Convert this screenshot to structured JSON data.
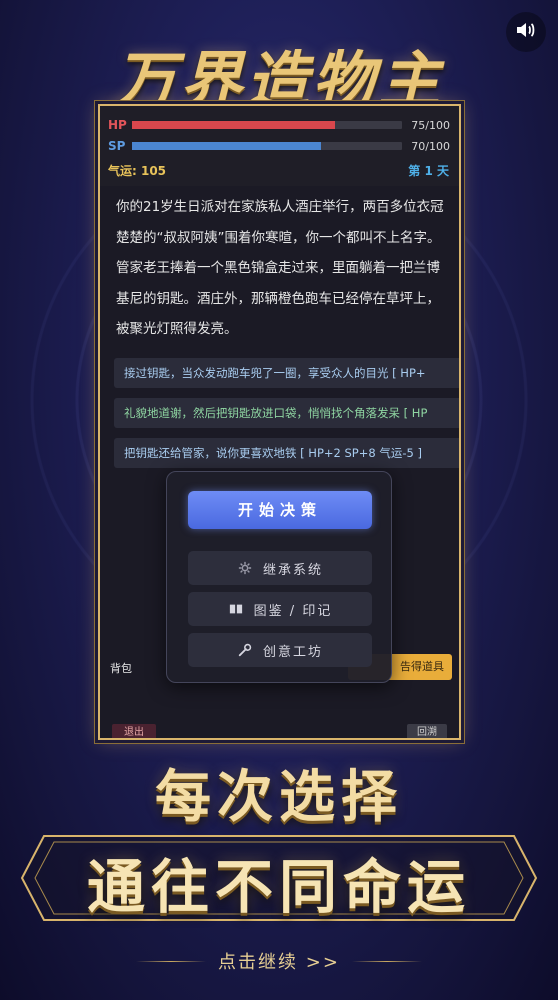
{
  "title": "万界造物主",
  "stats": {
    "hp": {
      "label": "HP",
      "current": 75,
      "max": 100,
      "text": "75/100",
      "color": "#d9474d"
    },
    "sp": {
      "label": "SP",
      "current": 70,
      "max": 100,
      "text": "70/100",
      "color": "#4b86d1"
    },
    "luck": "气运: 105",
    "day": "第 1 天"
  },
  "story": "你的21岁生日派对在家族私人酒庄举行，两百多位衣冠楚楚的“叔叔阿姨”围着你寒暄，你一个都叫不上名字。管家老王捧着一个黑色锦盒走过来，里面躺着一把兰博基尼的钥匙。酒庄外，那辆橙色跑车已经停在草坪上，被聚光灯照得发亮。",
  "choices": [
    {
      "text": "接过钥匙，当众发动跑车兜了一圈，享受众人的目光 [ HP+"
    },
    {
      "text": "礼貌地道谢，然后把钥匙放进口袋，悄悄找个角落发呆 [ HP"
    },
    {
      "text": "把钥匙还给管家，说你更喜欢地铁 [ HP+2  SP+8  气运-5 ]"
    }
  ],
  "bottom_bar": {
    "bag_label": "背包",
    "item_button": "告得道具",
    "exit_button": "退出",
    "back_button": "回溯"
  },
  "menu": {
    "start": "开始决策",
    "items": [
      {
        "label": "继承系统",
        "icon": "gear-icon"
      },
      {
        "label": "图鉴 / 印记",
        "icon": "book-icon"
      },
      {
        "label": "创意工坊",
        "icon": "wrench-icon"
      }
    ]
  },
  "slogan": {
    "line1": "每次选择",
    "line2": "通往不同命运"
  },
  "continue": "点击继续 >>",
  "colors": {
    "gold": "#e9c678",
    "start_button": "#5a78ea",
    "luck": "#e8c35a",
    "day": "#4fb0e8"
  }
}
